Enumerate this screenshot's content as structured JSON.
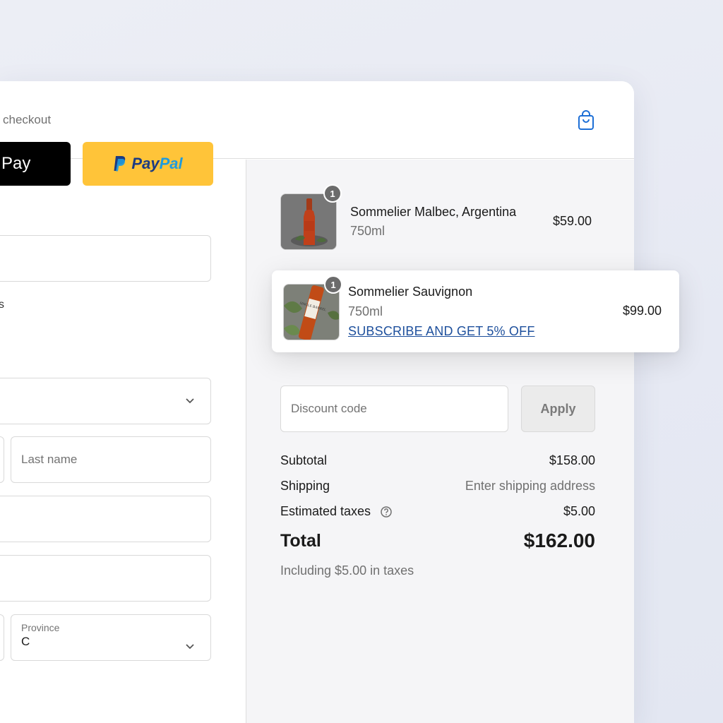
{
  "left": {
    "express_checkout_label": "checkout",
    "gpay_label": "Pay",
    "paypal": {
      "pay": "Pay",
      "pal": "Pal"
    },
    "stray_text": "s",
    "last_name_placeholder": "Last name",
    "province_label": "Province",
    "province_value": "C"
  },
  "cart": {
    "items": [
      {
        "name": "Sommelier Malbec, Argentina",
        "size": "750ml",
        "price": "$59.00",
        "qty": "1"
      },
      {
        "name": "Sommelier Sauvignon",
        "size": "750ml",
        "price": "$99.00",
        "qty": "1",
        "offer": "SUBSCRIBE AND GET 5% OFF",
        "label_text": "SINGLE BARREL"
      }
    ]
  },
  "discount": {
    "placeholder": "Discount code",
    "apply_label": "Apply"
  },
  "summary": {
    "subtotal_label": "Subtotal",
    "subtotal_value": "$158.00",
    "shipping_label": "Shipping",
    "shipping_value": "Enter shipping address",
    "taxes_label": "Estimated taxes",
    "taxes_value": "$5.00",
    "total_label": "Total",
    "total_value": "$162.00",
    "tax_note": "Including $5.00 in taxes"
  },
  "colors": {
    "accent": "#1d6fd6",
    "paypal_yellow": "#ffc439",
    "link_blue": "#1d4f9c"
  },
  "icons": [
    "shopping-bag-icon",
    "chevron-down-icon",
    "help-circle-icon",
    "paypal-logo-icon"
  ]
}
